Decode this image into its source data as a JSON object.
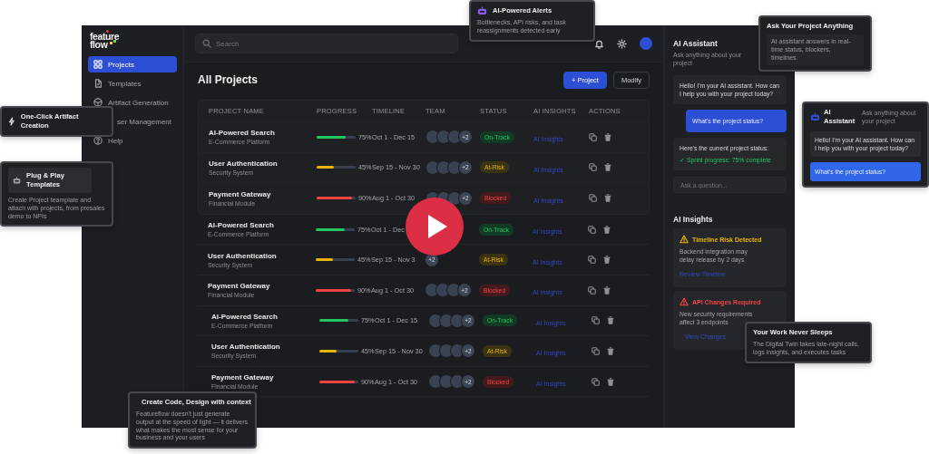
{
  "sidebar": {
    "logo": [
      "feature",
      "flow"
    ],
    "items": [
      {
        "label": "Projects",
        "selected": true
      },
      {
        "label": "Templates",
        "selected": false
      },
      {
        "label": "Artifact Generation",
        "selected": false
      },
      {
        "label": "ser Management",
        "selected": false
      },
      {
        "label": "Help",
        "selected": false
      }
    ]
  },
  "topbar": {
    "search": {
      "placeholder": "Search"
    }
  },
  "content": {
    "title": "All Projects",
    "buttons": [
      {
        "label": "+ Project",
        "kind": "primary"
      },
      {
        "label": "Modify",
        "kind": "secondary"
      }
    ]
  },
  "table": {
    "columns": [
      "PROJECT NAME",
      "PROGRESS",
      "TIMELINE",
      "TEAM",
      "STATUS",
      "AI INSIGHTS",
      "ACTIONS"
    ],
    "row_groups": [
      {
        "rows": [
          {
            "name": "AI-Powered Search",
            "subtitle": "E-Commerce Platform",
            "level": 0.75,
            "percent": "75%",
            "timeline": "Oct 1 - Dec 15",
            "team": {
              "extra": "+2",
              "avatars_visible": true
            },
            "status": {
              "label": "On-Track",
              "kind": "on-track"
            },
            "insights": "AI Insights"
          },
          {
            "name": "User Authentication",
            "subtitle": "Security System",
            "level": 0.45,
            "percent": "45%",
            "timeline": "Sep 15 - Nov 30",
            "team": {
              "extra": "+2",
              "avatars_visible": true
            },
            "status": {
              "label": "At-Risk",
              "kind": "at-risk"
            },
            "insights": "AI Insights"
          },
          {
            "name": "Payment Gateway",
            "subtitle": "Financial Module",
            "level": 0.9,
            "percent": "90%",
            "timeline": "Aug 1 - Oct 30",
            "team": {
              "extra": "+2",
              "avatars_visible": true
            },
            "status": {
              "label": "Blocked",
              "kind": "blocked"
            },
            "insights": "AI Insights"
          }
        ]
      },
      {
        "rows": [
          {
            "name": "AI-Powered Search",
            "subtitle": "E-Commerce Platform",
            "level": 0.75,
            "percent": "75%",
            "timeline": "Oct 1 - Dec",
            "status": {
              "label": "On-Track",
              "kind": "on-track"
            },
            "insights": "AI Insights"
          },
          {
            "name": "User Authentication",
            "subtitle": "Security System",
            "level": 0.45,
            "percent": "45%",
            "timeline": "Sep 15 - Nov 3",
            "team": {
              "extra": "+2",
              "avatars_visible": false
            },
            "status": {
              "label": "At-Risk",
              "kind": "at-risk"
            },
            "insights": "AI Insights"
          },
          {
            "name": "Payment Gateway",
            "subtitle": "Financial Module",
            "level": 0.9,
            "percent": "90%",
            "timeline": "Aug 1 - Oct 30",
            "team": {
              "extra": "+2",
              "avatars_visible": true
            },
            "status": {
              "label": "Blocked",
              "kind": "blocked"
            },
            "insights": "AI Insights"
          }
        ]
      },
      {
        "rows": [
          {
            "name": "AI-Powered Search",
            "subtitle": "E-Commerce Platform",
            "level": 0.75,
            "percent": "75%",
            "timeline": "Oct 1 - Dec 15",
            "team": {
              "extra": "+2",
              "avatars_visible": true
            },
            "status": {
              "label": "On-Track",
              "kind": "on-track"
            },
            "insights": "AI Insights"
          },
          {
            "name": "User Authentication",
            "subtitle": "Security System",
            "level": 0.45,
            "percent": "45%",
            "timeline": "Sep 15 - Nov 30",
            "team": {
              "extra": "+2",
              "avatars_visible": true
            },
            "status": {
              "label": "At-Risk",
              "kind": "at-risk"
            },
            "insights": "AI Insights"
          },
          {
            "name": "Payment Gateway",
            "subtitle": "Financial Module",
            "level": 0.9,
            "percent": "90%",
            "timeline": "Aug 1 - Oct 30",
            "team": {
              "extra": "+2",
              "avatars_visible": true
            },
            "status": {
              "label": "Blocked",
              "kind": "blocked"
            },
            "insights": "AI Insights"
          }
        ]
      }
    ]
  },
  "assistant": {
    "title": "AI Assistant",
    "subtitle": "Ask anything about your project",
    "messages": [
      {
        "kind": "assistant",
        "text": "Hello! I'm your AI assistant. How can I help you with your project today?"
      },
      {
        "kind": "user",
        "text": "What's the project status?"
      },
      {
        "kind": "assistant",
        "text": "Here's the current project status:",
        "status_line": "✓ Sprint progress: 75% complete"
      }
    ],
    "input": {
      "placeholder": "Ask a question..."
    }
  },
  "insights": {
    "title": "AI Insights",
    "cards": [
      {
        "kind": "warning",
        "title": "Timeline Risk Detected",
        "body": "Backend integration may delay release by 2 days",
        "link": "Review Timeline"
      },
      {
        "kind": "danger",
        "title": "API Changes Required",
        "body": "New security requirements affect 3 endpoints",
        "link": "View Changes"
      }
    ]
  },
  "callouts": [
    {
      "kind": "note",
      "title": "AI-Powered Alerts",
      "body": "Bottlenecks, API risks, and task reassignments detected early"
    },
    {
      "kind": "note",
      "title": "Ask Your Project Anything",
      "body": "AI assistant answers in real-time status, blockers, timelines."
    },
    {
      "kind": "chat",
      "title": "AI Assistant",
      "subtitle": "Ask anything about your project",
      "messages": [
        {
          "kind": "assistant",
          "text": "Hello! I'm your AI assistant. How can I help you with your project today?"
        },
        {
          "kind": "user",
          "text": "What's the project status?"
        }
      ]
    },
    {
      "kind": "note",
      "title": "Your Work Never Sleeps",
      "body": "The Digital Twin takes late-night calls, logs insights, and executes tasks"
    },
    {
      "kind": "note",
      "title": "One-Click Artifact Creation"
    },
    {
      "kind": "note",
      "title": "Plug & Play Templates",
      "body": "Create Project teamplate and attach with projects, from presales demo to NPIs"
    },
    {
      "kind": "note",
      "title": "Create Code, Design with context",
      "body": "Featureflow doesn't just generate output at the speed of light — it delivers what makes the most sense for your business and your users"
    }
  ]
}
